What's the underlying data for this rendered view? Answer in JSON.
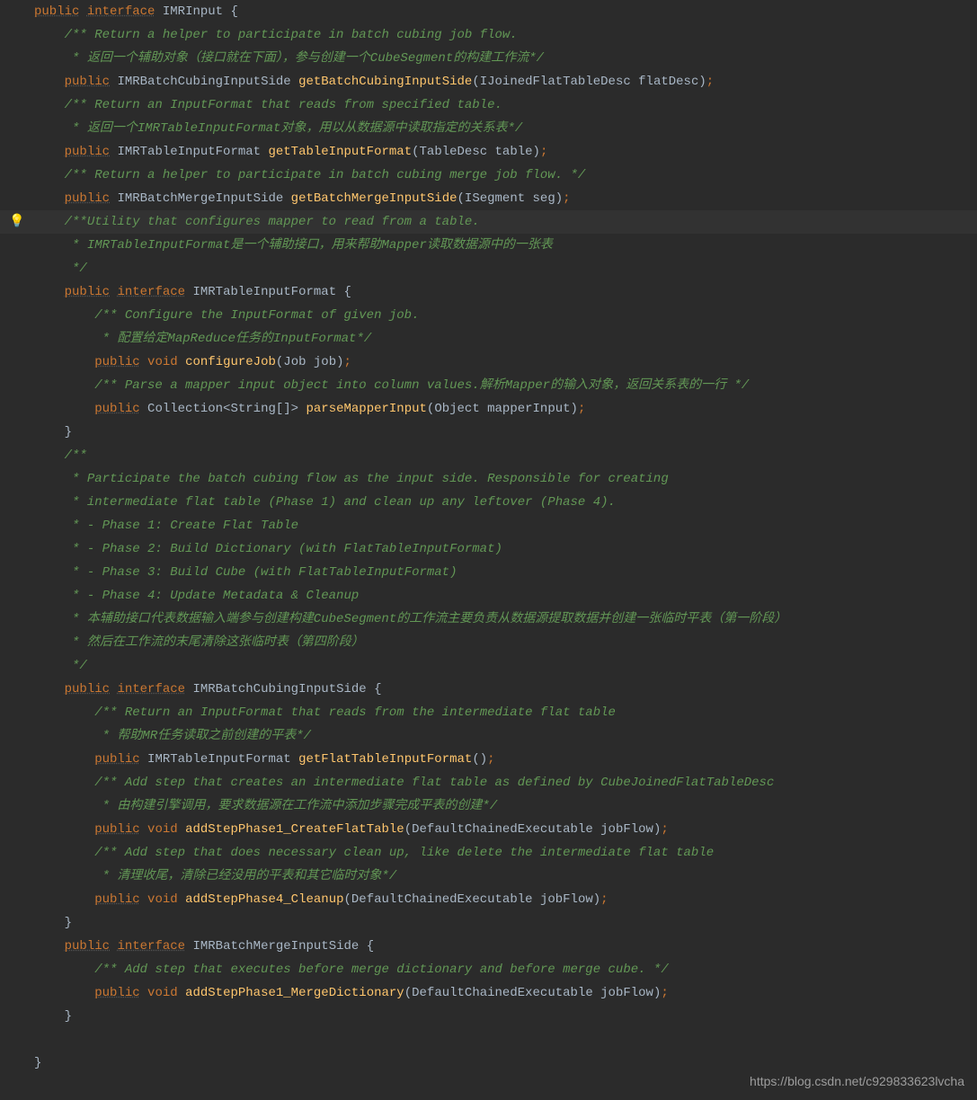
{
  "watermark": "https://blog.csdn.net/c929833623lvcha",
  "lines": [
    {
      "indent": 0,
      "tokens": [
        [
          "kw-u",
          "public"
        ],
        [
          "sp",
          " "
        ],
        [
          "kw-u",
          "interface"
        ],
        [
          "sp",
          " "
        ],
        [
          "type",
          "IMRInput"
        ],
        [
          "sp",
          " "
        ],
        [
          "paren",
          "{"
        ]
      ]
    },
    {
      "indent": 1,
      "tokens": [
        [
          "comment",
          "/** Return a helper to participate in batch cubing job flow."
        ]
      ]
    },
    {
      "indent": 1,
      "tokens": [
        [
          "comment",
          " * 返回一个辅助对象（接口就在下面），参与创建一个CubeSegment的构建工作流*/"
        ]
      ]
    },
    {
      "indent": 1,
      "tokens": [
        [
          "kw-u",
          "public"
        ],
        [
          "sp",
          " "
        ],
        [
          "type",
          "IMRBatchCubingInputSide "
        ],
        [
          "method",
          "getBatchCubingInputSide"
        ],
        [
          "paren",
          "("
        ],
        [
          "param",
          "IJoinedFlatTableDesc flatDesc"
        ],
        [
          "paren",
          ")"
        ],
        [
          "semi",
          ";"
        ]
      ]
    },
    {
      "indent": 1,
      "tokens": [
        [
          "comment",
          "/** Return an InputFormat that reads from specified table."
        ]
      ]
    },
    {
      "indent": 1,
      "tokens": [
        [
          "comment",
          " * 返回一个IMRTableInputFormat对象，用以从数据源中读取指定的关系表*/"
        ]
      ]
    },
    {
      "indent": 1,
      "tokens": [
        [
          "kw-u",
          "public"
        ],
        [
          "sp",
          " "
        ],
        [
          "type",
          "IMRTableInputFormat "
        ],
        [
          "method",
          "getTableInputFormat"
        ],
        [
          "paren",
          "("
        ],
        [
          "param",
          "TableDesc table"
        ],
        [
          "paren",
          ")"
        ],
        [
          "semi",
          ";"
        ]
      ]
    },
    {
      "indent": 1,
      "tokens": [
        [
          "comment",
          "/** Return a helper to participate in batch cubing merge job flow. */"
        ]
      ]
    },
    {
      "indent": 1,
      "tokens": [
        [
          "kw-u",
          "public"
        ],
        [
          "sp",
          " "
        ],
        [
          "type",
          "IMRBatchMergeInputSide "
        ],
        [
          "method",
          "getBatchMergeInputSide"
        ],
        [
          "paren",
          "("
        ],
        [
          "param",
          "ISegment seg"
        ],
        [
          "paren",
          ")"
        ],
        [
          "semi",
          ";"
        ]
      ]
    },
    {
      "indent": 1,
      "highlighted": true,
      "bulb": true,
      "tokens": [
        [
          "comment",
          "/**Utility that configures mapper to read from a table."
        ]
      ]
    },
    {
      "indent": 1,
      "tokens": [
        [
          "comment",
          " * IMRTableInputFormat是一个辅助接口，用来帮助Mapper读取数据源中的一张表"
        ]
      ]
    },
    {
      "indent": 1,
      "tokens": [
        [
          "comment",
          " */"
        ]
      ]
    },
    {
      "indent": 1,
      "tokens": [
        [
          "kw-u",
          "public"
        ],
        [
          "sp",
          " "
        ],
        [
          "kw-u",
          "interface"
        ],
        [
          "sp",
          " "
        ],
        [
          "type",
          "IMRTableInputFormat"
        ],
        [
          "sp",
          " "
        ],
        [
          "paren",
          "{"
        ]
      ]
    },
    {
      "indent": 2,
      "tokens": [
        [
          "comment",
          "/** Configure the InputFormat of given job."
        ]
      ]
    },
    {
      "indent": 2,
      "tokens": [
        [
          "comment",
          " * 配置给定MapReduce任务的InputFormat*/"
        ]
      ]
    },
    {
      "indent": 2,
      "tokens": [
        [
          "kw-u",
          "public"
        ],
        [
          "sp",
          " "
        ],
        [
          "kw",
          "void "
        ],
        [
          "method",
          "configureJob"
        ],
        [
          "paren",
          "("
        ],
        [
          "param",
          "Job job"
        ],
        [
          "paren",
          ")"
        ],
        [
          "semi",
          ";"
        ]
      ]
    },
    {
      "indent": 2,
      "tokens": [
        [
          "comment",
          "/** Parse a mapper input object into column values.解析Mapper的输入对象，返回关系表的一行 */"
        ]
      ]
    },
    {
      "indent": 2,
      "tokens": [
        [
          "kw-u",
          "public"
        ],
        [
          "sp",
          " "
        ],
        [
          "type",
          "Collection<String[]> "
        ],
        [
          "method",
          "parseMapperInput"
        ],
        [
          "paren",
          "("
        ],
        [
          "param",
          "Object mapperInput"
        ],
        [
          "paren",
          ")"
        ],
        [
          "semi",
          ";"
        ]
      ]
    },
    {
      "indent": 1,
      "tokens": [
        [
          "paren",
          "}"
        ]
      ]
    },
    {
      "indent": 1,
      "tokens": [
        [
          "comment",
          "/**"
        ]
      ]
    },
    {
      "indent": 1,
      "tokens": [
        [
          "comment",
          " * Participate the batch cubing flow as the input side. Responsible for creating"
        ]
      ]
    },
    {
      "indent": 1,
      "tokens": [
        [
          "comment",
          " * intermediate flat table (Phase 1) and clean up any leftover (Phase 4)."
        ]
      ]
    },
    {
      "indent": 1,
      "tokens": [
        [
          "comment",
          " * - Phase 1: Create Flat Table"
        ]
      ]
    },
    {
      "indent": 1,
      "tokens": [
        [
          "comment",
          " * - Phase 2: Build Dictionary (with FlatTableInputFormat)"
        ]
      ]
    },
    {
      "indent": 1,
      "tokens": [
        [
          "comment",
          " * - Phase 3: Build Cube (with FlatTableInputFormat)"
        ]
      ]
    },
    {
      "indent": 1,
      "tokens": [
        [
          "comment",
          " * - Phase 4: Update Metadata & Cleanup"
        ]
      ]
    },
    {
      "indent": 1,
      "tokens": [
        [
          "comment",
          " * 本辅助接口代表数据输入端参与创建构建CubeSegment的工作流主要负责从数据源提取数据并创建一张临时平表（第一阶段）"
        ]
      ]
    },
    {
      "indent": 1,
      "tokens": [
        [
          "comment",
          " * 然后在工作流的末尾清除这张临时表（第四阶段）"
        ]
      ]
    },
    {
      "indent": 1,
      "tokens": [
        [
          "comment",
          " */"
        ]
      ]
    },
    {
      "indent": 1,
      "tokens": [
        [
          "kw-u",
          "public"
        ],
        [
          "sp",
          " "
        ],
        [
          "kw-u",
          "interface"
        ],
        [
          "sp",
          " "
        ],
        [
          "type",
          "IMRBatchCubingInputSide"
        ],
        [
          "sp",
          " "
        ],
        [
          "paren",
          "{"
        ]
      ]
    },
    {
      "indent": 2,
      "tokens": [
        [
          "comment",
          "/** Return an InputFormat that reads from the intermediate flat table"
        ]
      ]
    },
    {
      "indent": 2,
      "tokens": [
        [
          "comment",
          " * 帮助MR任务读取之前创建的平表*/"
        ]
      ]
    },
    {
      "indent": 2,
      "tokens": [
        [
          "kw-u",
          "public"
        ],
        [
          "sp",
          " "
        ],
        [
          "type",
          "IMRTableInputFormat "
        ],
        [
          "method",
          "getFlatTableInputFormat"
        ],
        [
          "paren",
          "()"
        ],
        [
          "semi",
          ";"
        ]
      ]
    },
    {
      "indent": 2,
      "tokens": [
        [
          "comment",
          "/** Add step that creates an intermediate flat table as defined by CubeJoinedFlatTableDesc"
        ]
      ]
    },
    {
      "indent": 2,
      "tokens": [
        [
          "comment",
          " * 由构建引擎调用，要求数据源在工作流中添加步骤完成平表的创建*/"
        ]
      ]
    },
    {
      "indent": 2,
      "tokens": [
        [
          "kw-u",
          "public"
        ],
        [
          "sp",
          " "
        ],
        [
          "kw",
          "void "
        ],
        [
          "method",
          "addStepPhase1_CreateFlatTable"
        ],
        [
          "paren",
          "("
        ],
        [
          "param",
          "DefaultChainedExecutable jobFlow"
        ],
        [
          "paren",
          ")"
        ],
        [
          "semi",
          ";"
        ]
      ]
    },
    {
      "indent": 2,
      "tokens": [
        [
          "comment",
          "/** Add step that does necessary clean up, like delete the intermediate flat table"
        ]
      ]
    },
    {
      "indent": 2,
      "tokens": [
        [
          "comment",
          " * 清理收尾，清除已经没用的平表和其它临时对象*/"
        ]
      ]
    },
    {
      "indent": 2,
      "tokens": [
        [
          "kw-u",
          "public"
        ],
        [
          "sp",
          " "
        ],
        [
          "kw",
          "void "
        ],
        [
          "method",
          "addStepPhase4_Cleanup"
        ],
        [
          "paren",
          "("
        ],
        [
          "param",
          "DefaultChainedExecutable jobFlow"
        ],
        [
          "paren",
          ")"
        ],
        [
          "semi",
          ";"
        ]
      ]
    },
    {
      "indent": 1,
      "tokens": [
        [
          "paren",
          "}"
        ]
      ]
    },
    {
      "indent": 1,
      "tokens": [
        [
          "kw-u",
          "public"
        ],
        [
          "sp",
          " "
        ],
        [
          "kw-u",
          "interface"
        ],
        [
          "sp",
          " "
        ],
        [
          "type",
          "IMRBatchMergeInputSide"
        ],
        [
          "sp",
          " "
        ],
        [
          "paren",
          "{"
        ]
      ]
    },
    {
      "indent": 2,
      "tokens": [
        [
          "comment",
          "/** Add step that executes before merge dictionary and before merge cube. */"
        ]
      ]
    },
    {
      "indent": 2,
      "tokens": [
        [
          "kw-u",
          "public"
        ],
        [
          "sp",
          " "
        ],
        [
          "kw",
          "void "
        ],
        [
          "method",
          "addStepPhase1_MergeDictionary"
        ],
        [
          "paren",
          "("
        ],
        [
          "param",
          "DefaultChainedExecutable jobFlow"
        ],
        [
          "paren",
          ")"
        ],
        [
          "semi",
          ";"
        ]
      ]
    },
    {
      "indent": 1,
      "tokens": [
        [
          "paren",
          "}"
        ]
      ]
    },
    {
      "indent": 0,
      "blank": true
    },
    {
      "indent": 0,
      "tokens": [
        [
          "paren",
          "}"
        ]
      ]
    }
  ]
}
